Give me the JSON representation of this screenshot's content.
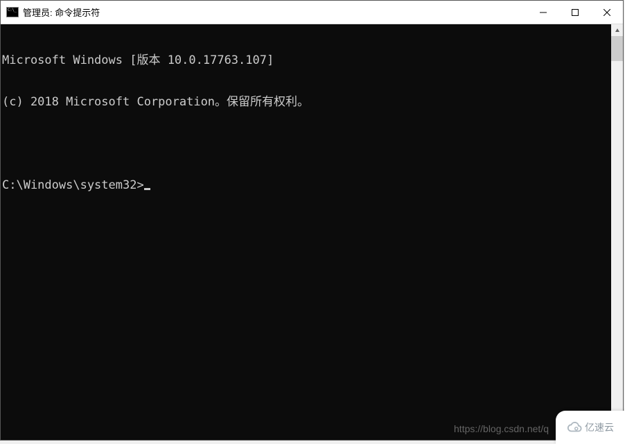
{
  "titlebar": {
    "text": "管理员: 命令提示符"
  },
  "terminal": {
    "line1": "Microsoft Windows [版本 10.0.17763.107]",
    "line2": "(c) 2018 Microsoft Corporation。保留所有权利。",
    "prompt": "C:\\Windows\\system32>"
  },
  "watermark": {
    "url_text": "https://blog.csdn.net/q",
    "brand": "亿速云"
  }
}
